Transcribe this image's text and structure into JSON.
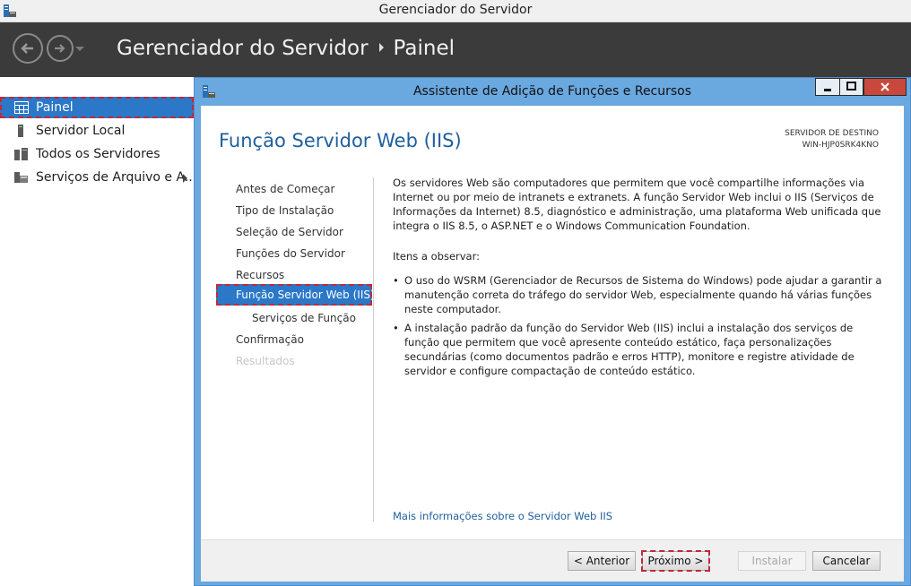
{
  "window": {
    "title": "Gerenciador do Servidor"
  },
  "header": {
    "breadcrumb": [
      "Gerenciador do Servidor",
      "Painel"
    ]
  },
  "sidebar": {
    "items": [
      {
        "label": "Painel",
        "icon": "dashboard-icon",
        "selected": true
      },
      {
        "label": "Servidor Local",
        "icon": "server-icon",
        "selected": false
      },
      {
        "label": "Todos os Servidores",
        "icon": "servers-icon",
        "selected": false
      },
      {
        "label": "Serviços de Arquivo e A...",
        "icon": "file-services-icon",
        "selected": false
      }
    ]
  },
  "dialog": {
    "title": "Assistente de Adição de Funções e Recursos",
    "heading": "Função Servidor Web (IIS)",
    "destination_label": "SERVIDOR DE DESTINO",
    "destination_server": "WIN-HJP0SRK4KNO",
    "steps": [
      {
        "label": "Antes de Começar",
        "state": "normal"
      },
      {
        "label": "Tipo de Instalação",
        "state": "normal"
      },
      {
        "label": "Seleção de Servidor",
        "state": "normal"
      },
      {
        "label": "Funções do Servidor",
        "state": "normal"
      },
      {
        "label": "Recursos",
        "state": "normal"
      },
      {
        "label": "Função Servidor Web (IIS)",
        "state": "current"
      },
      {
        "label": "Serviços de Função",
        "state": "sub"
      },
      {
        "label": "Confirmação",
        "state": "normal"
      },
      {
        "label": "Resultados",
        "state": "disabled"
      }
    ],
    "description": "Os servidores Web são computadores que permitem que você compartilhe informações via Internet ou por meio de intranets e extranets. A função Servidor Web inclui o IIS (Serviços de Informações da Internet) 8.5, diagnóstico e administração, uma plataforma Web unificada que integra o IIS 8.5, o ASP.NET e o Windows Communication Foundation.",
    "notes_title": "Itens a observar:",
    "notes": [
      "O uso do WSRM (Gerenciador de Recursos de Sistema do Windows) pode ajudar a garantir a manutenção correta do tráfego do servidor Web, especialmente quando há várias funções neste computador.",
      "A instalação padrão da função do Servidor Web (IIS) inclui a instalação dos serviços de função que permitem que você apresente conteúdo estático, faça personalizações secundárias (como documentos padrão e erros HTTP), monitore e registre atividade de servidor e configure compactação de conteúdo estático."
    ],
    "more_info_link": "Mais informações sobre o Servidor Web IIS",
    "buttons": {
      "previous": "< Anterior",
      "next": "Próximo >",
      "install": "Instalar",
      "cancel": "Cancelar"
    }
  },
  "colors": {
    "accent": "#2a78c7",
    "header_bg": "#3b3b3b",
    "dialog_frame": "#6aa8e0",
    "heading": "#1f5f9e",
    "highlight_dash": "#c0293a"
  }
}
